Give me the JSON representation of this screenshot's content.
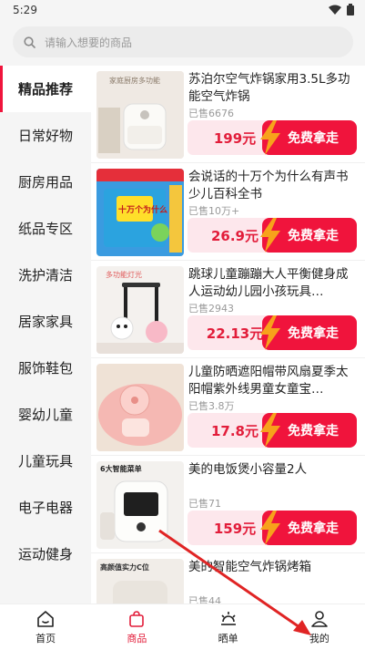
{
  "status_bar": {
    "time": "5:29"
  },
  "search": {
    "placeholder": "请输入想要的商品"
  },
  "categories": [
    {
      "label": "精品推荐"
    },
    {
      "label": "日常好物"
    },
    {
      "label": "厨房用品"
    },
    {
      "label": "纸品专区"
    },
    {
      "label": "洗护清洁"
    },
    {
      "label": "居家家具"
    },
    {
      "label": "服饰鞋包"
    },
    {
      "label": "婴幼儿童"
    },
    {
      "label": "儿童玩具"
    },
    {
      "label": "电子电器"
    },
    {
      "label": "运动健身"
    }
  ],
  "products": [
    {
      "title": "苏泊尔空气炸锅家用3.5L多功能空气炸锅",
      "sold": "已售6676",
      "price": "199元",
      "action": "免费拿走",
      "thumb_text": "家庭厨房多功能"
    },
    {
      "title": "会说话的十万个为什么有声书少儿百科全书",
      "sold": "已售10万+",
      "price": "26.9元",
      "action": "免费拿走",
      "thumb_text": "十万个为什么"
    },
    {
      "title": "跳球儿童蹦蹦大人平衡健身成人运动幼儿园小孩玩具…",
      "sold": "已售2943",
      "price": "22.13元",
      "action": "免费拿走",
      "thumb_text": "多功能灯光"
    },
    {
      "title": "儿童防晒遮阳帽带风扇夏季太阳帽紫外线男童女童宝…",
      "sold": "已售3.8万",
      "price": "17.8元",
      "action": "免费拿走",
      "thumb_text": ""
    },
    {
      "title": "美的电饭煲小容量2人",
      "sold": "已售71",
      "price": "159元",
      "action": "免费拿走",
      "thumb_text": "6大智能菜单"
    },
    {
      "title": "美的智能空气炸锅烤箱",
      "sold": "已售44",
      "price": "",
      "action": "",
      "thumb_text": "高颜值实力C位"
    }
  ],
  "tabs": [
    {
      "label": "首页",
      "icon": "home-icon"
    },
    {
      "label": "商品",
      "icon": "shopping-bag-icon"
    },
    {
      "label": "晒单",
      "icon": "sun-icon"
    },
    {
      "label": "我的",
      "icon": "user-icon"
    }
  ],
  "colors": {
    "accent": "#f0143c",
    "price_bg": "#fde7ec",
    "bolt": "#f7a21b"
  }
}
